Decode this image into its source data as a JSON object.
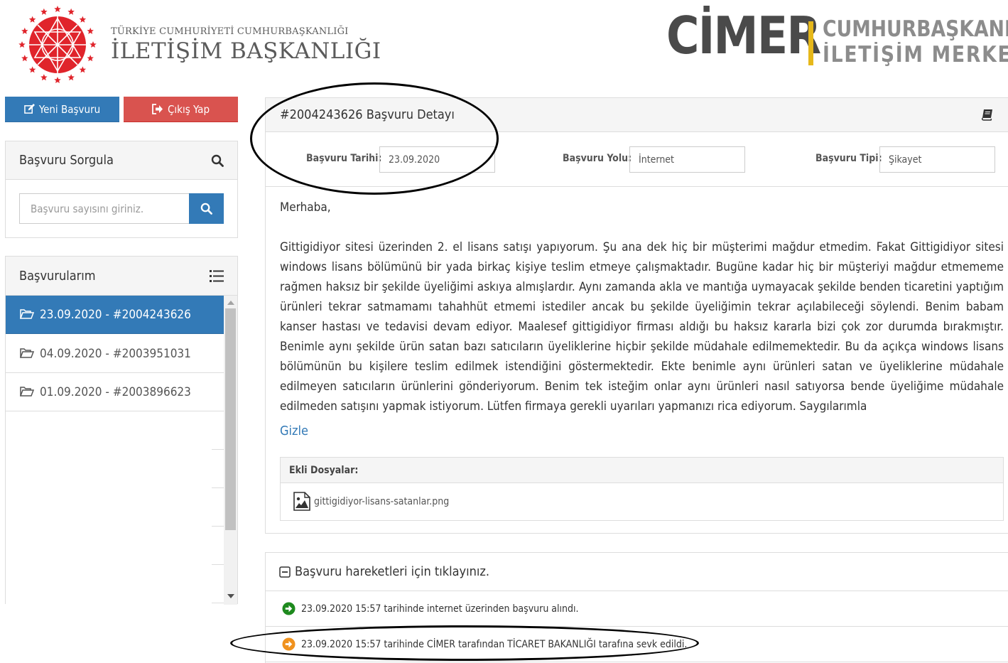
{
  "header": {
    "org_small": "TÜRKİYE CUMHURİYETİ CUMHURBAŞKANLIĞI",
    "org_big": "İLETİŞİM BAŞKANLIĞI",
    "cimer_word": "CİMER",
    "cimer_sub1": "CUMHURBAŞKANLIĞI",
    "cimer_sub2": "İLETİŞİM MERKEZİ",
    "brand_red": "#e0242b",
    "brand_gold": "#e6b81a"
  },
  "actions": {
    "new_label": "Yeni Başvuru",
    "new_icon": "edit-icon",
    "logout_label": "Çıkış Yap",
    "logout_icon": "sign-out-icon"
  },
  "search": {
    "title": "Başvuru Sorgula",
    "placeholder": "Başvuru sayısını giriniz."
  },
  "applications": {
    "title": "Başvurularım",
    "items": [
      {
        "label": "23.09.2020 - #2004243626",
        "active": true
      },
      {
        "label": "04.09.2020 - #2003951031",
        "active": false
      },
      {
        "label": "01.09.2020 - #2003896623",
        "active": false
      }
    ]
  },
  "detail": {
    "title": "#2004243626 Başvuru Detayı",
    "date_label": "Başvuru Tarihi:",
    "date_value": "23.09.2020",
    "channel_label": "Başvuru Yolu:",
    "channel_value": "İnternet",
    "type_label": "Başvuru Tipi:",
    "type_value": "Şikayet",
    "greeting": "Merhaba,",
    "body": "Gittigidiyor sitesi üzerinden 2. el lisans satışı yapıyorum. Şu ana dek hiç bir müşterimi mağdur etmedim. Fakat Gittigidiyor sitesi windows lisans bölümünü bir yada birkaç kişiye teslim etmeye çalışmaktadır. Bugüne kadar hiç bir müşteriyi mağdur etmememe rağmen haksız bir şekilde üyeliğimi askıya almışlardır. Aynı zamanda akla ve mantığa uymayacak şekilde benden ticaretini yaptığım ürünleri tekrar satmamamı tahahhüt etmemi istediler ancak bu şekilde üyeliğimin tekrar açılabileceği söylendi. Benim babam kanser hastası ve tedavisi devam ediyor. Maalesef gittigidiyor firması aldığı bu haksız kararla bizi çok zor durumda bırakmıştır. Benimle aynı şekilde ürün satan bazı satıcıların üyeliklerine hiçbir şekilde müdahale edilmemektedir. Bu da açıkça windows lisans bölümünün bu kişilere teslim edilmek istendiğini göstermektedir. Ekte benimle aynı ürünleri satan ve üyeliklerine müdahale edilmeyen satıcıların ürünlerini gönderiyorum. Benim tek isteğim onlar aynı ürünleri nasıl satıyorsa bende üyeliğime müdahale edilmeden satışını yapmak istiyorum. Lütfen firmaya gerekli uyarıları yapmanızı rica ediyorum. Saygılarımla",
    "hide_link": "Gizle",
    "files_title": "Ekli Dosyalar:",
    "file_name": "gittigidiyor-lisans-satanlar.png"
  },
  "history": {
    "title": "Başvuru hareketleri için tıklayınız.",
    "events": [
      {
        "text": "23.09.2020 15:57 tarihinde internet üzerinden başvuru alındı.",
        "color": "#1e8a1e"
      },
      {
        "text": "23.09.2020 15:57 tarihinde CİMER tarafından TİCARET BAKANLIĞI tarafına sevk edildi.",
        "color": "#f0921e"
      }
    ]
  }
}
